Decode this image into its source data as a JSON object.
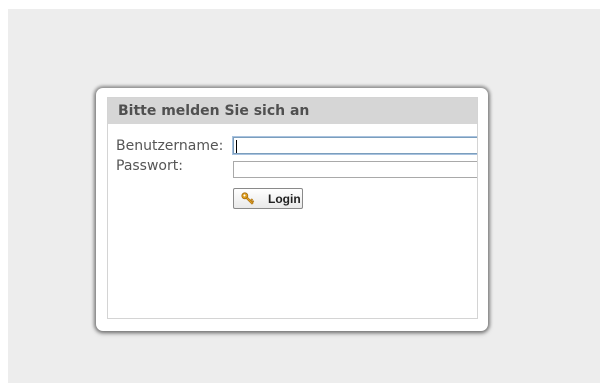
{
  "login": {
    "title": "Bitte melden Sie sich an",
    "username_label": "Benutzername:",
    "password_label": "Passwort:",
    "username_value": "",
    "password_value": "",
    "submit_label": "Login",
    "submit_icon": "key-icon"
  },
  "colors": {
    "page_background": "#ededed",
    "header_background": "#d6d6d6",
    "header_text": "#505050",
    "label_text": "#555555",
    "focus_border": "#7b9ebd",
    "key_icon": "#e0a020"
  }
}
